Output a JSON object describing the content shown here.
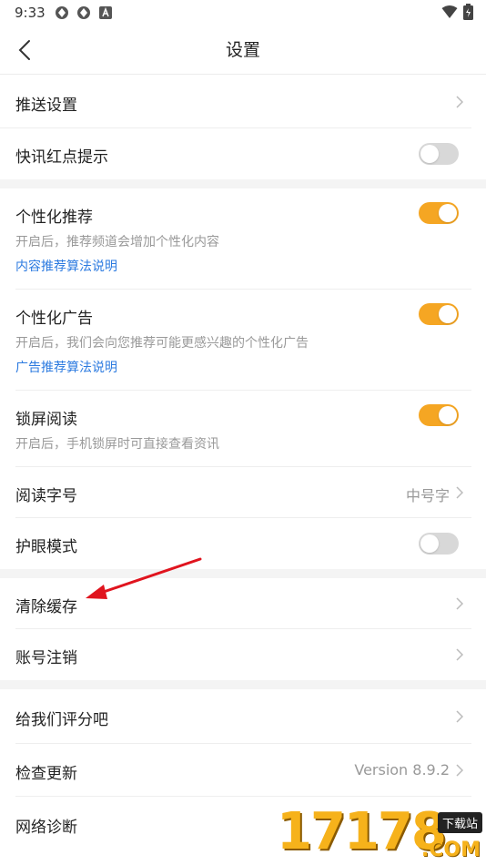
{
  "status_bar": {
    "time": "9:33",
    "icons": [
      "app-notification-icon",
      "app-notification-icon",
      "a-badge-icon"
    ],
    "right_icons": [
      "wifi-icon",
      "battery-icon"
    ]
  },
  "nav": {
    "title": "设置",
    "back_icon": "back-chevron-icon"
  },
  "settings": {
    "push_settings": {
      "label": "推送设置"
    },
    "flash_red_dot": {
      "label": "快讯红点提示",
      "enabled": false
    },
    "personalized_recommend": {
      "label": "个性化推荐",
      "desc": "开启后，推荐频道会增加个性化内容",
      "link": "内容推荐算法说明",
      "enabled": true
    },
    "personalized_ads": {
      "label": "个性化广告",
      "desc": "开启后，我们会向您推荐可能更感兴趣的个性化广告",
      "link": "广告推荐算法说明",
      "enabled": true
    },
    "lockscreen_reading": {
      "label": "锁屏阅读",
      "desc": "开启后，手机锁屏时可直接查看资讯",
      "enabled": true
    },
    "font_size": {
      "label": "阅读字号",
      "value": "中号字"
    },
    "eye_protection": {
      "label": "护眼模式",
      "enabled": false
    },
    "clear_cache": {
      "label": "清除缓存"
    },
    "account_cancel": {
      "label": "账号注销"
    },
    "rate_us": {
      "label": "给我们评分吧"
    },
    "check_update": {
      "label": "检查更新",
      "value": "Version 8.9.2"
    },
    "network_diagnose": {
      "label": "网络诊断"
    }
  },
  "colors": {
    "toggle_on": "#f5a623",
    "toggle_off": "#d8d8d8",
    "link": "#2d7be0",
    "annotation_arrow": "#e0141e"
  },
  "watermark": {
    "digits": "17178",
    "tag": "下载站",
    "suffix": ".COM"
  }
}
